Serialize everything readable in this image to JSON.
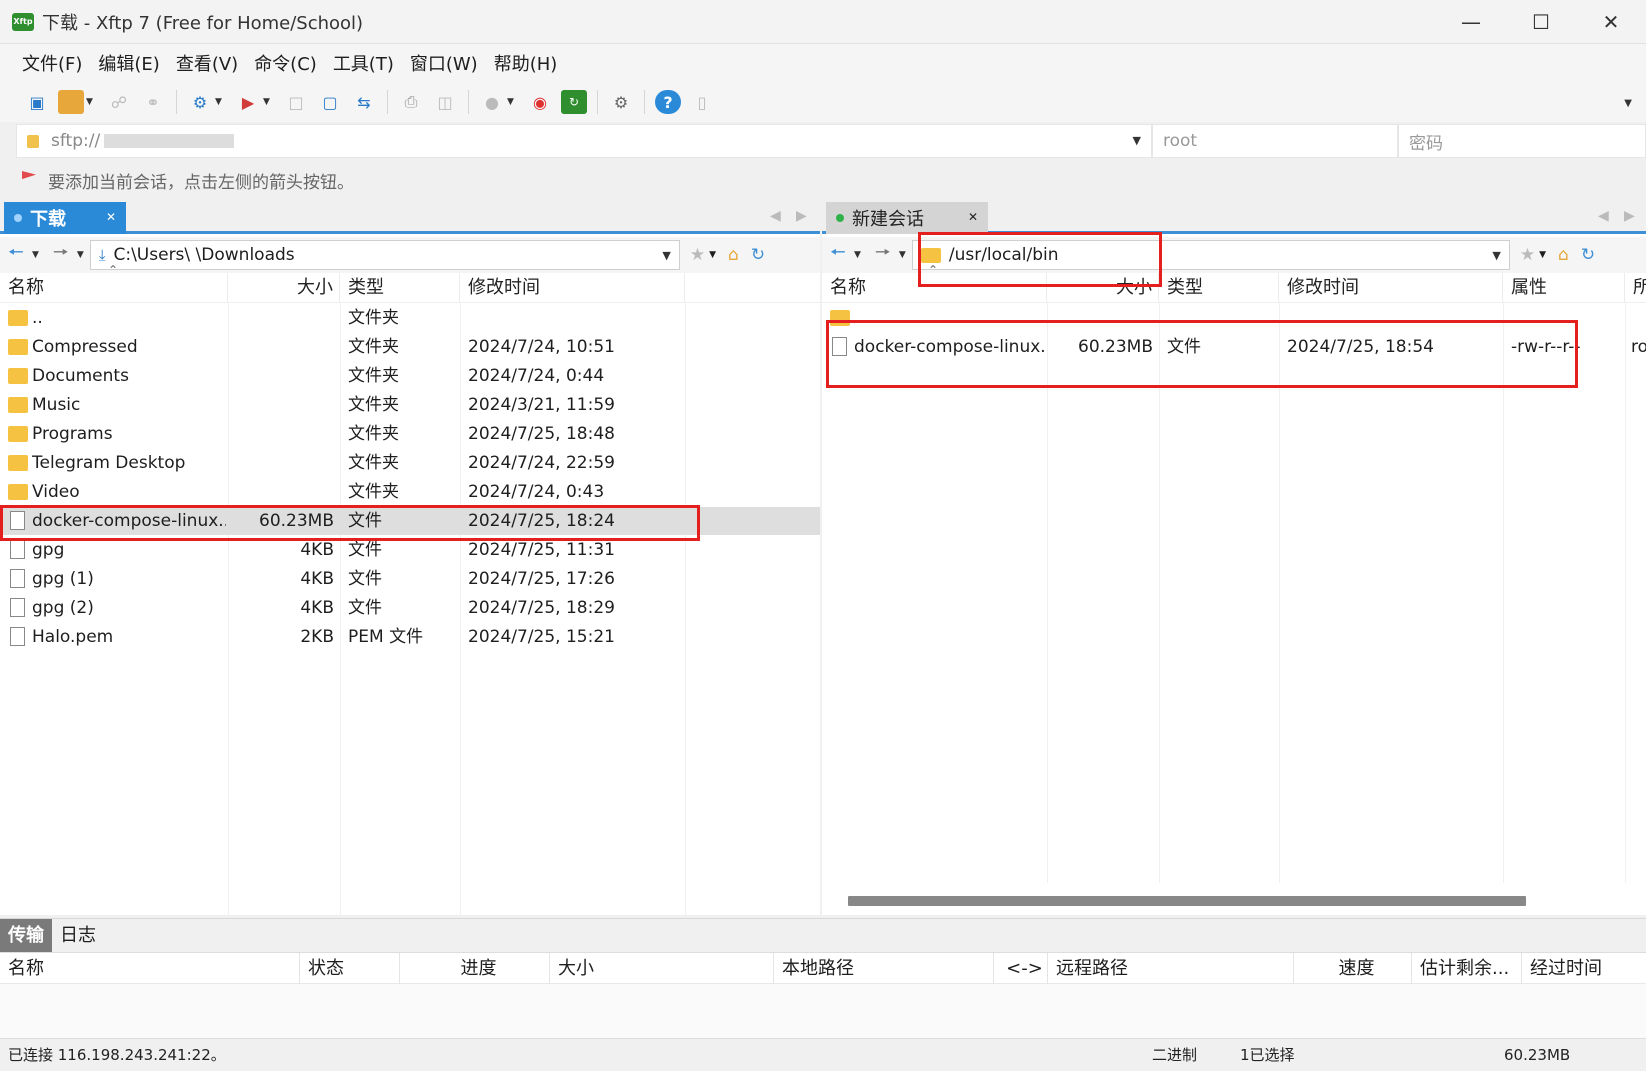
{
  "window": {
    "title": "下载 - Xftp 7 (Free for Home/School)",
    "app_icon": "Xftp"
  },
  "menu": [
    "文件(F)",
    "编辑(E)",
    "查看(V)",
    "命令(C)",
    "工具(T)",
    "窗口(W)",
    "帮助(H)"
  ],
  "address": {
    "host": "sftp://",
    "user_placeholder": "root",
    "password_placeholder": "密码"
  },
  "hint": "要添加当前会话，点击左侧的箭头按钮。",
  "left": {
    "tab_label": "下载",
    "path": "C:\\Users\\          \\Downloads",
    "columns": {
      "name": "名称",
      "size": "大小",
      "type": "类型",
      "modified": "修改时间"
    },
    "rows": [
      {
        "name": "..",
        "size": "",
        "type": "文件夹",
        "modified": "",
        "kind": "folder"
      },
      {
        "name": "Compressed",
        "size": "",
        "type": "文件夹",
        "modified": "2024/7/24, 10:51",
        "kind": "folder"
      },
      {
        "name": "Documents",
        "size": "",
        "type": "文件夹",
        "modified": "2024/7/24, 0:44",
        "kind": "folder"
      },
      {
        "name": "Music",
        "size": "",
        "type": "文件夹",
        "modified": "2024/3/21, 11:59",
        "kind": "folder"
      },
      {
        "name": "Programs",
        "size": "",
        "type": "文件夹",
        "modified": "2024/7/25, 18:48",
        "kind": "folder"
      },
      {
        "name": "Telegram Desktop",
        "size": "",
        "type": "文件夹",
        "modified": "2024/7/24, 22:59",
        "kind": "folder"
      },
      {
        "name": "Video",
        "size": "",
        "type": "文件夹",
        "modified": "2024/7/24, 0:43",
        "kind": "folder"
      },
      {
        "name": "docker-compose-linux...",
        "size": "60.23MB",
        "type": "文件",
        "modified": "2024/7/25, 18:24",
        "kind": "file"
      },
      {
        "name": "gpg",
        "size": "4KB",
        "type": "文件",
        "modified": "2024/7/25, 11:31",
        "kind": "file"
      },
      {
        "name": "gpg (1)",
        "size": "4KB",
        "type": "文件",
        "modified": "2024/7/25, 17:26",
        "kind": "file"
      },
      {
        "name": "gpg (2)",
        "size": "4KB",
        "type": "文件",
        "modified": "2024/7/25, 18:29",
        "kind": "file"
      },
      {
        "name": "Halo.pem",
        "size": "2KB",
        "type": "PEM 文件",
        "modified": "2024/7/25, 15:21",
        "kind": "file"
      }
    ]
  },
  "right": {
    "tab_label": "新建会话",
    "path": "/usr/local/bin",
    "columns": {
      "name": "名称",
      "size": "大小",
      "type": "类型",
      "modified": "修改时间",
      "attr": "属性",
      "owner": "所"
    },
    "rows": [
      {
        "name": "..",
        "size": "",
        "type": "",
        "modified": "",
        "attr": "",
        "owner": "",
        "kind": "folder"
      },
      {
        "name": "docker-compose-linux...",
        "size": "60.23MB",
        "type": "文件",
        "modified": "2024/7/25, 18:54",
        "attr": "-rw-r--r--",
        "owner": "ro",
        "kind": "file"
      }
    ]
  },
  "transfer": {
    "tabs": [
      "传输",
      "日志"
    ],
    "columns": [
      "名称",
      "状态",
      "进度",
      "大小",
      "本地路径",
      "<->",
      "远程路径",
      "速度",
      "估计剩余...",
      "经过时间"
    ]
  },
  "status": {
    "connection": "已连接 116.198.243.241:22。",
    "mode": "二进制",
    "selection": "1已选择",
    "size": "60.23MB"
  },
  "colors": {
    "accent": "#2b8ad8",
    "highlight_box": "#e51e1e",
    "folder": "#f5c242"
  }
}
